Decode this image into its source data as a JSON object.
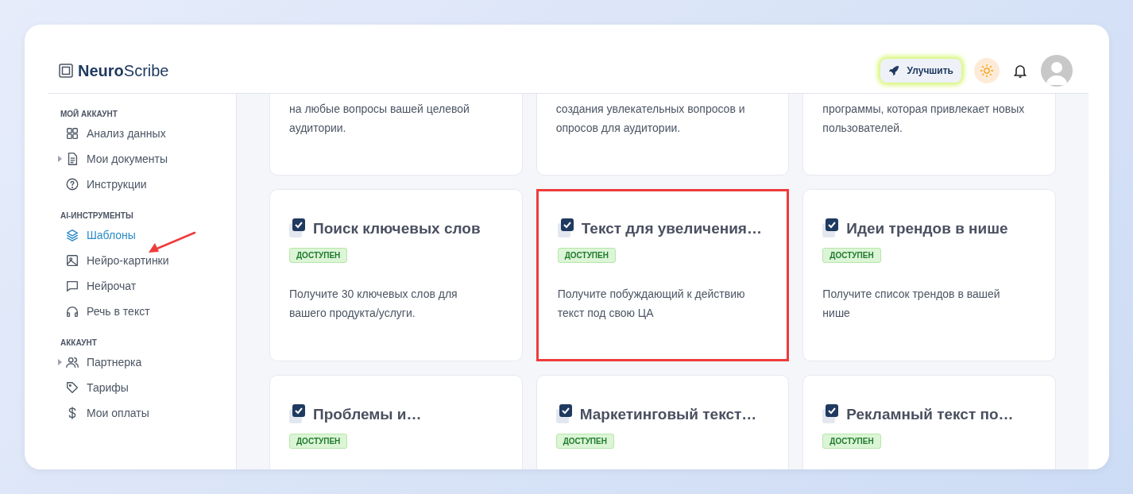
{
  "logo": {
    "bold": "Neuro",
    "light": "Scribe"
  },
  "header": {
    "upgrade_button": "Улучшить"
  },
  "sidebar": [
    {
      "heading": "МОЙ АККАУНТ",
      "items": [
        {
          "label": "Анализ данных",
          "kind": "grid",
          "expandable": false,
          "selected": false
        },
        {
          "label": "Мои документы",
          "kind": "document",
          "expandable": true,
          "selected": false
        },
        {
          "label": "Инструкции",
          "kind": "help",
          "expandable": false,
          "selected": false
        }
      ]
    },
    {
      "heading": "AI-ИНСТРУМЕНТЫ",
      "items": [
        {
          "label": "Шаблоны",
          "kind": "layers",
          "expandable": false,
          "selected": true
        },
        {
          "label": "Нейро-картинки",
          "kind": "image",
          "expandable": false,
          "selected": false
        },
        {
          "label": "Нейрочат",
          "kind": "chat",
          "expandable": false,
          "selected": false
        },
        {
          "label": "Речь в текст",
          "kind": "headphones",
          "expandable": false,
          "selected": false
        }
      ]
    },
    {
      "heading": "АККАУНТ",
      "items": [
        {
          "label": "Партнерка",
          "kind": "users",
          "expandable": true,
          "selected": false
        },
        {
          "label": "Тарифы",
          "kind": "tag",
          "expandable": false,
          "selected": false
        },
        {
          "label": "Мои оплаты",
          "kind": "dollar",
          "expandable": false,
          "selected": false
        }
      ]
    }
  ],
  "cards": [
    {
      "description": "на любые вопросы вашей целевой аудитории.",
      "highlighted": false
    },
    {
      "description": "создания увлекательных вопросов и опросов для аудитории.",
      "highlighted": false
    },
    {
      "description": "программы, которая привлекает новых пользователей.",
      "highlighted": false
    },
    {
      "title": "Поиск ключевых слов",
      "badge": "ДОСТУПЕН",
      "description": "Получите 30 ключевых слов для вашего продукта/услуги.",
      "highlighted": false
    },
    {
      "title": "Текст для увеличения…",
      "badge": "ДОСТУПЕН",
      "description": "Получите побуждающий к действию текст под свою ЦА",
      "highlighted": true
    },
    {
      "title": "Идеи трендов в нише",
      "badge": "ДОСТУПЕН",
      "description": "Получите список трендов в вашей нише",
      "highlighted": false
    },
    {
      "title": "Проблемы и…",
      "badge": "ДОСТУПЕН",
      "highlighted": false
    },
    {
      "title": "Маркетинговый текст…",
      "badge": "ДОСТУПЕН",
      "highlighted": false
    },
    {
      "title": "Рекламный текст по…",
      "badge": "ДОСТУПЕН",
      "highlighted": false
    }
  ]
}
